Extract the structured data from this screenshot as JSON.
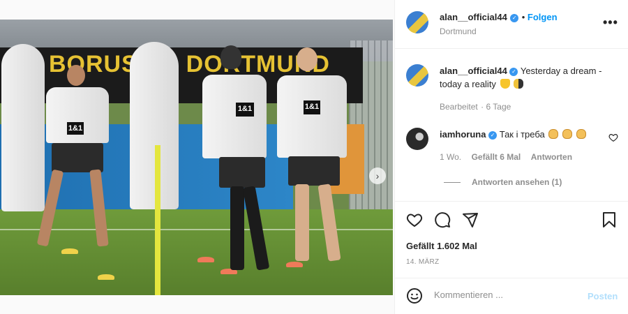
{
  "photo": {
    "banner_text": "BORUSSIA DORTMUND",
    "sponsor": "1&1",
    "slides": 5,
    "active_slide": 0
  },
  "post": {
    "author": {
      "username": "alan__official44",
      "location": "Dortmund",
      "verified": true
    },
    "follow_label": "Folgen",
    "caption": {
      "username": "alan__official44",
      "text": "Yesterday a dream - today a reality",
      "emojis": [
        "yellow-heart",
        "bee"
      ],
      "edited_label": "Bearbeitet",
      "age": "6 Tage"
    },
    "comments": [
      {
        "username": "iamhoruna",
        "verified": true,
        "text": "Так і треба",
        "emojis": [
          "clapping-hands",
          "clapping-hands",
          "clapping-hands"
        ],
        "age": "1 Wo.",
        "likes_label": "Gefällt 6 Mal",
        "reply_label": "Antworten",
        "view_replies_label": "Antworten ansehen (1)"
      }
    ],
    "likes_label": "Gefällt 1.602 Mal",
    "date": "14. MÄRZ",
    "comment_placeholder": "Kommentieren ...",
    "post_button": "Posten"
  },
  "colors": {
    "accent": "#0095f6",
    "verified": "#3897f0",
    "post_disabled": "#b2dffc",
    "muted": "#8e8e8e"
  }
}
